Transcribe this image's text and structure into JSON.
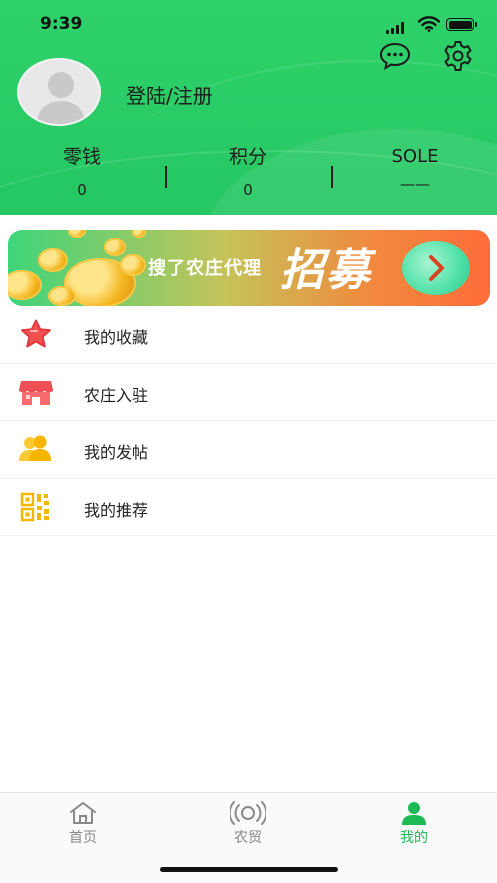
{
  "status_bar": {
    "time": "9:39"
  },
  "header": {
    "login_text": "登陆/注册",
    "message_icon": "chat-bubble-icon",
    "settings_icon": "gear-icon",
    "stats": [
      {
        "label": "零钱",
        "value": "0"
      },
      {
        "label": "积分",
        "value": "0"
      },
      {
        "label": "SOLE",
        "value": "——"
      }
    ]
  },
  "banner": {
    "headline": "搜了农庄代理",
    "big_text": "招募",
    "arrow_icon": "chevron-right-icon"
  },
  "menu": {
    "items": [
      {
        "label": "我的收藏",
        "icon": "star-icon"
      },
      {
        "label": "农庄入驻",
        "icon": "shop-icon"
      },
      {
        "label": "我的发帖",
        "icon": "users-icon"
      },
      {
        "label": "我的推荐",
        "icon": "qr-code-icon"
      }
    ]
  },
  "tabbar": {
    "tabs": [
      {
        "label": "首页",
        "icon": "home-icon",
        "active": false
      },
      {
        "label": "农贸",
        "icon": "broadcast-icon",
        "active": false
      },
      {
        "label": "我的",
        "icon": "person-icon",
        "active": true
      }
    ]
  },
  "colors": {
    "brand_green": "#25c763",
    "active_tab": "#1db954",
    "inactive_tab": "#888888"
  }
}
